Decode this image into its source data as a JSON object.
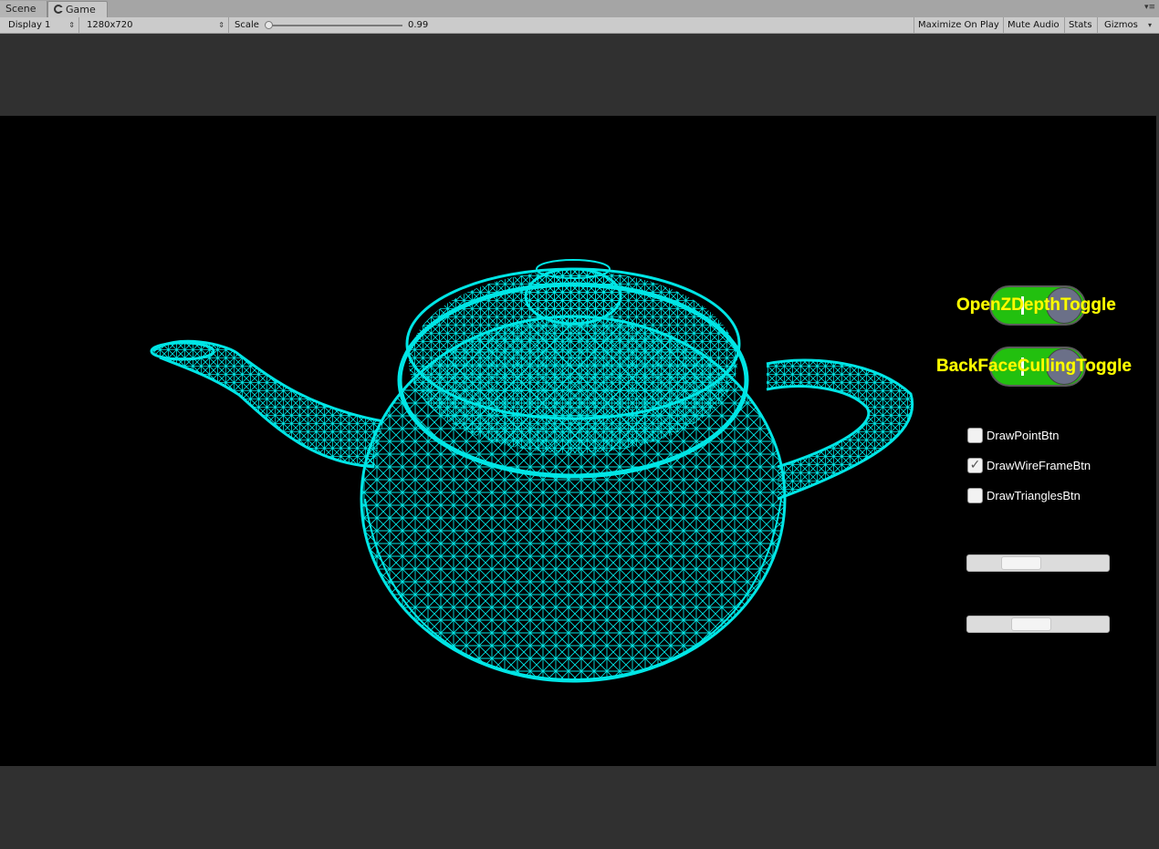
{
  "tabs": [
    {
      "label": "Scene",
      "active": false
    },
    {
      "label": "Game",
      "active": true
    }
  ],
  "toolbar": {
    "display": "Display 1",
    "resolution": "1280x720",
    "scale_label": "Scale",
    "scale_value": "0.99",
    "maximize_on_play": "Maximize On Play",
    "mute_audio": "Mute Audio",
    "stats": "Stats",
    "gizmos": "Gizmos"
  },
  "viewport": {
    "background": "#000000",
    "wire_color": "#00e5e5"
  },
  "controls": {
    "toggles": [
      {
        "label": "OpenZDepthToggle",
        "on": true
      },
      {
        "label": "BackFaceCullingToggle",
        "on": true
      }
    ],
    "checkboxes": [
      {
        "label": "DrawPointBtn",
        "checked": false
      },
      {
        "label": "DrawWireFrameBtn",
        "checked": true
      },
      {
        "label": "DrawTrianglesBtn",
        "checked": false
      }
    ],
    "sliders": [
      {
        "value": 0.4
      },
      {
        "value": 0.45
      }
    ]
  },
  "colors": {
    "toggle_on": "#22c00f",
    "toggle_label": "#ffff00",
    "editor_bg": "#303030"
  }
}
